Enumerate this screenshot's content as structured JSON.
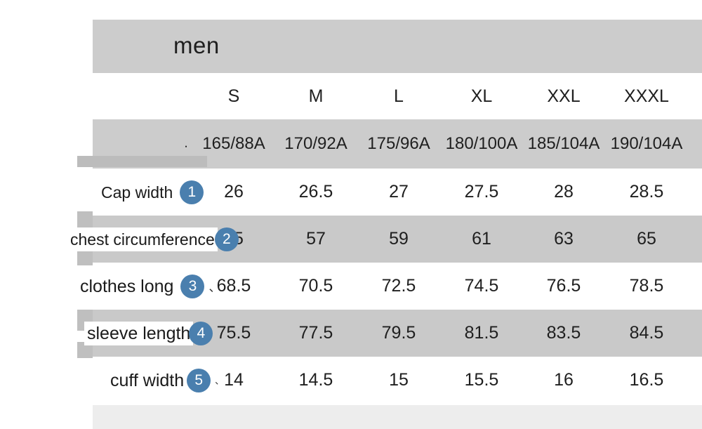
{
  "chart_data": {
    "type": "table",
    "title": "men",
    "columns": [
      "S",
      "M",
      "L",
      "XL",
      "XXL",
      "XXXL"
    ],
    "column_codes": [
      "165/88A",
      "170/92A",
      "175/96A",
      "180/100A",
      "185/104A",
      "190/104A"
    ],
    "row_label_header": "",
    "rows": [
      {
        "index": "1",
        "label": "Cap width",
        "values": [
          "26",
          "26.5",
          "27",
          "27.5",
          "28",
          "28.5"
        ]
      },
      {
        "index": "2",
        "label": "chest circumference",
        "values": [
          "55",
          "57",
          "59",
          "61",
          "63",
          "65"
        ]
      },
      {
        "index": "3",
        "label": "clothes long",
        "values": [
          "68.5",
          "70.5",
          "72.5",
          "74.5",
          "76.5",
          "78.5"
        ]
      },
      {
        "index": "4",
        "label": "sleeve length",
        "values": [
          "75.5",
          "77.5",
          "79.5",
          "81.5",
          "83.5",
          "84.5"
        ]
      },
      {
        "index": "5",
        "label": "cuff width",
        "values": [
          "14",
          "14.5",
          "15",
          "15.5",
          "16",
          "16.5"
        ]
      }
    ],
    "units": "",
    "xlabel": "",
    "ylabel": "",
    "grid": false,
    "legend": "none"
  },
  "marks": {
    "code_row_tick": "⸳",
    "row_tick": "、"
  },
  "colors": {
    "badge": "#4a7fae",
    "header_band": "#cccccc",
    "row_alt": "#c9c9c9",
    "left_block": "#bfbfbf",
    "footer": "#ededed",
    "text": "#1f1f1f"
  }
}
